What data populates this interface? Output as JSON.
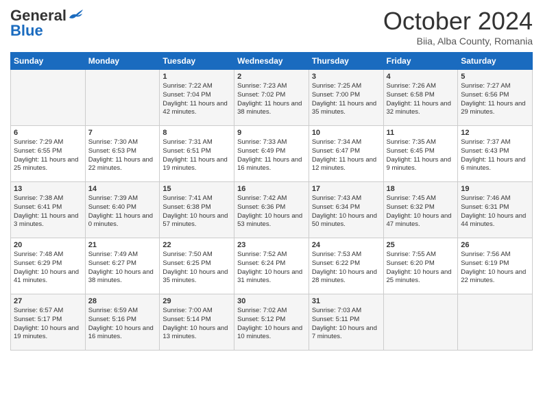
{
  "header": {
    "logo_general": "General",
    "logo_blue": "Blue",
    "title": "October 2024",
    "location": "Biia, Alba County, Romania"
  },
  "weekdays": [
    "Sunday",
    "Monday",
    "Tuesday",
    "Wednesday",
    "Thursday",
    "Friday",
    "Saturday"
  ],
  "weeks": [
    [
      {
        "day": "",
        "sunrise": "",
        "sunset": "",
        "daylight": ""
      },
      {
        "day": "",
        "sunrise": "",
        "sunset": "",
        "daylight": ""
      },
      {
        "day": "1",
        "sunrise": "Sunrise: 7:22 AM",
        "sunset": "Sunset: 7:04 PM",
        "daylight": "Daylight: 11 hours and 42 minutes."
      },
      {
        "day": "2",
        "sunrise": "Sunrise: 7:23 AM",
        "sunset": "Sunset: 7:02 PM",
        "daylight": "Daylight: 11 hours and 38 minutes."
      },
      {
        "day": "3",
        "sunrise": "Sunrise: 7:25 AM",
        "sunset": "Sunset: 7:00 PM",
        "daylight": "Daylight: 11 hours and 35 minutes."
      },
      {
        "day": "4",
        "sunrise": "Sunrise: 7:26 AM",
        "sunset": "Sunset: 6:58 PM",
        "daylight": "Daylight: 11 hours and 32 minutes."
      },
      {
        "day": "5",
        "sunrise": "Sunrise: 7:27 AM",
        "sunset": "Sunset: 6:56 PM",
        "daylight": "Daylight: 11 hours and 29 minutes."
      }
    ],
    [
      {
        "day": "6",
        "sunrise": "Sunrise: 7:29 AM",
        "sunset": "Sunset: 6:55 PM",
        "daylight": "Daylight: 11 hours and 25 minutes."
      },
      {
        "day": "7",
        "sunrise": "Sunrise: 7:30 AM",
        "sunset": "Sunset: 6:53 PM",
        "daylight": "Daylight: 11 hours and 22 minutes."
      },
      {
        "day": "8",
        "sunrise": "Sunrise: 7:31 AM",
        "sunset": "Sunset: 6:51 PM",
        "daylight": "Daylight: 11 hours and 19 minutes."
      },
      {
        "day": "9",
        "sunrise": "Sunrise: 7:33 AM",
        "sunset": "Sunset: 6:49 PM",
        "daylight": "Daylight: 11 hours and 16 minutes."
      },
      {
        "day": "10",
        "sunrise": "Sunrise: 7:34 AM",
        "sunset": "Sunset: 6:47 PM",
        "daylight": "Daylight: 11 hours and 12 minutes."
      },
      {
        "day": "11",
        "sunrise": "Sunrise: 7:35 AM",
        "sunset": "Sunset: 6:45 PM",
        "daylight": "Daylight: 11 hours and 9 minutes."
      },
      {
        "day": "12",
        "sunrise": "Sunrise: 7:37 AM",
        "sunset": "Sunset: 6:43 PM",
        "daylight": "Daylight: 11 hours and 6 minutes."
      }
    ],
    [
      {
        "day": "13",
        "sunrise": "Sunrise: 7:38 AM",
        "sunset": "Sunset: 6:41 PM",
        "daylight": "Daylight: 11 hours and 3 minutes."
      },
      {
        "day": "14",
        "sunrise": "Sunrise: 7:39 AM",
        "sunset": "Sunset: 6:40 PM",
        "daylight": "Daylight: 11 hours and 0 minutes."
      },
      {
        "day": "15",
        "sunrise": "Sunrise: 7:41 AM",
        "sunset": "Sunset: 6:38 PM",
        "daylight": "Daylight: 10 hours and 57 minutes."
      },
      {
        "day": "16",
        "sunrise": "Sunrise: 7:42 AM",
        "sunset": "Sunset: 6:36 PM",
        "daylight": "Daylight: 10 hours and 53 minutes."
      },
      {
        "day": "17",
        "sunrise": "Sunrise: 7:43 AM",
        "sunset": "Sunset: 6:34 PM",
        "daylight": "Daylight: 10 hours and 50 minutes."
      },
      {
        "day": "18",
        "sunrise": "Sunrise: 7:45 AM",
        "sunset": "Sunset: 6:32 PM",
        "daylight": "Daylight: 10 hours and 47 minutes."
      },
      {
        "day": "19",
        "sunrise": "Sunrise: 7:46 AM",
        "sunset": "Sunset: 6:31 PM",
        "daylight": "Daylight: 10 hours and 44 minutes."
      }
    ],
    [
      {
        "day": "20",
        "sunrise": "Sunrise: 7:48 AM",
        "sunset": "Sunset: 6:29 PM",
        "daylight": "Daylight: 10 hours and 41 minutes."
      },
      {
        "day": "21",
        "sunrise": "Sunrise: 7:49 AM",
        "sunset": "Sunset: 6:27 PM",
        "daylight": "Daylight: 10 hours and 38 minutes."
      },
      {
        "day": "22",
        "sunrise": "Sunrise: 7:50 AM",
        "sunset": "Sunset: 6:25 PM",
        "daylight": "Daylight: 10 hours and 35 minutes."
      },
      {
        "day": "23",
        "sunrise": "Sunrise: 7:52 AM",
        "sunset": "Sunset: 6:24 PM",
        "daylight": "Daylight: 10 hours and 31 minutes."
      },
      {
        "day": "24",
        "sunrise": "Sunrise: 7:53 AM",
        "sunset": "Sunset: 6:22 PM",
        "daylight": "Daylight: 10 hours and 28 minutes."
      },
      {
        "day": "25",
        "sunrise": "Sunrise: 7:55 AM",
        "sunset": "Sunset: 6:20 PM",
        "daylight": "Daylight: 10 hours and 25 minutes."
      },
      {
        "day": "26",
        "sunrise": "Sunrise: 7:56 AM",
        "sunset": "Sunset: 6:19 PM",
        "daylight": "Daylight: 10 hours and 22 minutes."
      }
    ],
    [
      {
        "day": "27",
        "sunrise": "Sunrise: 6:57 AM",
        "sunset": "Sunset: 5:17 PM",
        "daylight": "Daylight: 10 hours and 19 minutes."
      },
      {
        "day": "28",
        "sunrise": "Sunrise: 6:59 AM",
        "sunset": "Sunset: 5:16 PM",
        "daylight": "Daylight: 10 hours and 16 minutes."
      },
      {
        "day": "29",
        "sunrise": "Sunrise: 7:00 AM",
        "sunset": "Sunset: 5:14 PM",
        "daylight": "Daylight: 10 hours and 13 minutes."
      },
      {
        "day": "30",
        "sunrise": "Sunrise: 7:02 AM",
        "sunset": "Sunset: 5:12 PM",
        "daylight": "Daylight: 10 hours and 10 minutes."
      },
      {
        "day": "31",
        "sunrise": "Sunrise: 7:03 AM",
        "sunset": "Sunset: 5:11 PM",
        "daylight": "Daylight: 10 hours and 7 minutes."
      },
      {
        "day": "",
        "sunrise": "",
        "sunset": "",
        "daylight": ""
      },
      {
        "day": "",
        "sunrise": "",
        "sunset": "",
        "daylight": ""
      }
    ]
  ]
}
